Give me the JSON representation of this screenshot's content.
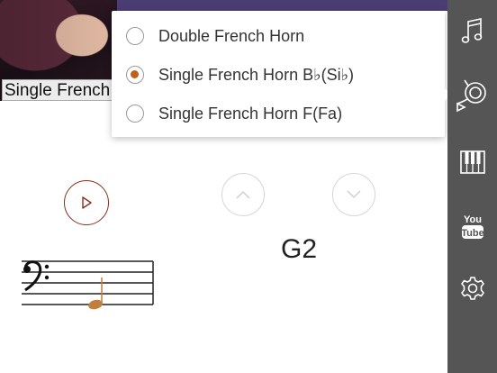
{
  "photo": {
    "caption": "Single French"
  },
  "instrument_menu": {
    "options": [
      {
        "label": "Double French Horn",
        "selected": false
      },
      {
        "label": "Single French Horn B♭(Si♭)",
        "selected": true
      },
      {
        "label": "Single French Horn F(Fa)",
        "selected": false
      }
    ]
  },
  "player": {
    "note_name": "G2"
  },
  "sidebar": {
    "items": [
      {
        "icon": "music-note-icon"
      },
      {
        "icon": "french-horn-icon"
      },
      {
        "icon": "piano-keys-icon"
      },
      {
        "icon": "youtube-icon",
        "label": "You Tube"
      },
      {
        "icon": "settings-gear-icon"
      }
    ]
  },
  "colors": {
    "accent": "#c0611a",
    "play_border": "#8a2f1a",
    "sidebar_bg": "#555555"
  }
}
